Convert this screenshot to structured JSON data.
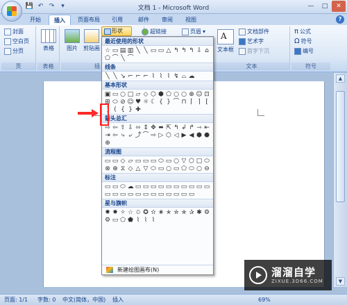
{
  "window": {
    "title": "文档 1 - Microsoft Word",
    "minimize": "—",
    "maximize": "□",
    "close": "✕"
  },
  "quick_access": [
    "💾",
    "↶",
    "↷",
    "▾"
  ],
  "tabs": [
    {
      "label": "开始",
      "active": false
    },
    {
      "label": "插入",
      "active": true
    },
    {
      "label": "页面布局",
      "active": false
    },
    {
      "label": "引用",
      "active": false
    },
    {
      "label": "邮件",
      "active": false
    },
    {
      "label": "审阅",
      "active": false
    },
    {
      "label": "视图",
      "active": false
    }
  ],
  "ribbon": {
    "pages_group": {
      "label": "页",
      "items": [
        "封面",
        "空白页",
        "分页"
      ]
    },
    "tables_group": {
      "label": "表格",
      "table": "表格"
    },
    "illustrations_group": {
      "picture": "图片",
      "clipart": "剪贴画",
      "shapes": "形状",
      "label": "插"
    },
    "links_group": {
      "hyperlink": "超链接"
    },
    "header_group": {
      "header": "页眉"
    },
    "text_group": {
      "label": "文本",
      "textbox": "文本框",
      "items": [
        "文档部件",
        "艺术字",
        "首字下沉"
      ]
    },
    "symbols_group": {
      "label": "符号",
      "items": [
        "公式",
        "符号",
        "编号"
      ]
    }
  },
  "shapes_menu": {
    "sections": [
      {
        "title": "最近使用的形状",
        "glyphs": [
          "☆",
          "▭",
          "▤",
          "▥",
          "╲",
          "╲",
          "▭",
          "▭",
          "△",
          "↰",
          "↰",
          "↰",
          "⇩",
          "⌂",
          "⬠",
          "⌒",
          "╲",
          "⌒"
        ]
      },
      {
        "title": "线条",
        "glyphs": [
          "╲",
          "╲",
          "↘",
          "⌐",
          "⌐",
          "⌐",
          "⌇",
          "⌇",
          "⌇",
          "↯",
          "⌓",
          "☁"
        ]
      },
      {
        "title": "基本形状",
        "glyphs": [
          "▣",
          "▭",
          "○",
          "□",
          "▱",
          "◇",
          "⬡",
          "⬢",
          "⬠",
          "○",
          "○",
          "⊕",
          "☺",
          "⊡",
          "⊞",
          "⬭",
          "⊘",
          "☺",
          "♥",
          "☼",
          "☾",
          "{",
          "}",
          "⌒",
          "⊓",
          "⌈",
          "⌉",
          "⁅",
          "⁆",
          "(",
          "{",
          "}",
          "✚"
        ]
      },
      {
        "title": "箭头总汇",
        "glyphs": [
          "⇨",
          "⇦",
          "⇧",
          "⇩",
          "⬄",
          "⇕",
          "✥",
          "⬌",
          "⇱",
          "↰",
          "↲",
          "↱",
          "⇾",
          "⇤",
          "⇥",
          "⇦",
          "⤷",
          "⤶",
          "⤴",
          "⌒",
          "⇨",
          "▷",
          "⬡",
          "◁",
          "▶",
          "◀",
          "⬢",
          "⬣",
          "⊕"
        ]
      },
      {
        "title": "流程图",
        "glyphs": [
          "▭",
          "▭",
          "◇",
          "▱",
          "▭",
          "▭",
          "▭",
          "⬭",
          "▭",
          "○",
          "▽",
          "⬡",
          "□",
          "⬭",
          "⊗",
          "⊕",
          "⧖",
          "◇",
          "△",
          "▽",
          "⬭",
          "▭",
          "○",
          "▭",
          "⬠",
          "⬭",
          "○",
          "⊖"
        ]
      },
      {
        "title": "标注",
        "glyphs": [
          "▭",
          "▭",
          "⬭",
          "☁",
          "▭",
          "▭",
          "▭",
          "▭",
          "▭",
          "▭",
          "▭",
          "▭",
          "▭",
          "▭",
          "▭",
          "▭",
          "▭",
          "▭",
          "▭",
          "▭",
          "▭",
          "▭",
          "▭",
          "▭",
          "▭",
          "▭"
        ]
      },
      {
        "title": "星与旗帜",
        "glyphs": [
          "✹",
          "✸",
          "✧",
          "☆",
          "✩",
          "✪",
          "✫",
          "✬",
          "✭",
          "✮",
          "✯",
          "✰",
          "✱",
          "⚙",
          "⚙",
          "▭",
          "⬠",
          "⬟",
          "⌇",
          "⌇",
          "⌇"
        ]
      }
    ],
    "footer": "新建绘图画布(N)"
  },
  "statusbar": {
    "page": "页面: 1/1",
    "words": "字数: 0",
    "lang": "中文(简体，中国)",
    "mode": "插入",
    "zoom": "69%"
  },
  "watermark": {
    "main": "溜溜自学",
    "sub": "ZIXUE.3D66.COM"
  }
}
